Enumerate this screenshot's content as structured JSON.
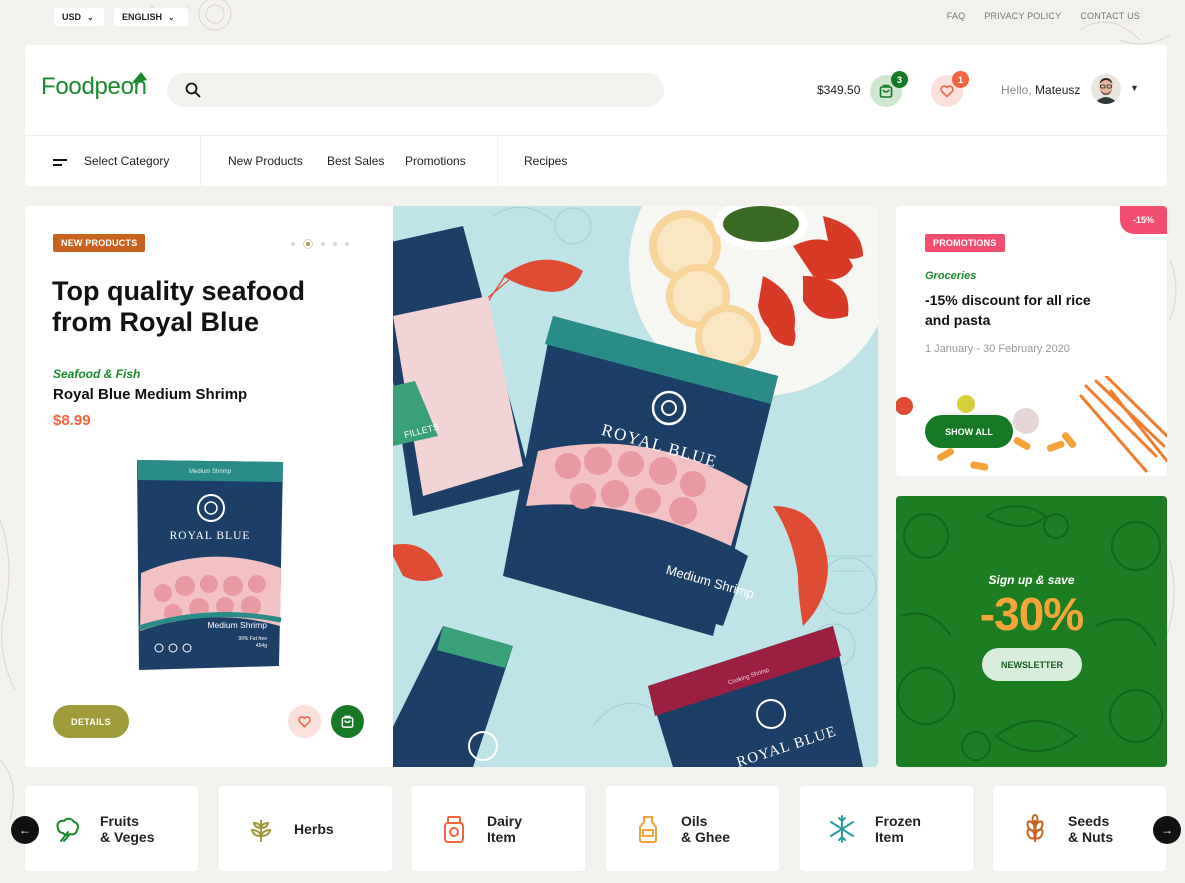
{
  "topbar": {
    "currency": "USD",
    "language": "ENGLISH",
    "links": [
      "FAQ",
      "PRIVACY POLICY",
      "CONTACT US"
    ]
  },
  "header": {
    "logo": "Foodpeon",
    "search_placeholder": "",
    "cart_total": "$349.50",
    "cart_count": "3",
    "wishlist_count": "1",
    "greeting": "Hello,",
    "user_name": "Mateusz"
  },
  "nav": {
    "category_label": "Select Category",
    "items": [
      "New Products",
      "Best Sales",
      "Promotions",
      "Recipes"
    ]
  },
  "hero": {
    "tag": "NEW PRODUCTS",
    "title": "Top quality seafood from Royal Blue",
    "category": "Seafood & Fish",
    "product_name": "Royal Blue Medium Shrimp",
    "price": "$8.99",
    "details_label": "DETAILS",
    "slide_count": 5,
    "active_slide": 2,
    "pack_brand": "ROYAL BLUE",
    "pack_type": "Medium Shrimp",
    "pack_type_2": "Cooking Shrimp",
    "pack_fat": "99% Fat free",
    "pack_weight": "454g",
    "pack_side": "FILLETS",
    "pack_top": "Medium Shrimp"
  },
  "promo": {
    "tag": "PROMOTIONS",
    "ribbon": "-15%",
    "category": "Groceries",
    "title": "-15% discount for all rice and pasta",
    "date": "1 January - 30 February 2020",
    "button": "SHOW ALL"
  },
  "newsletter": {
    "tagline": "Sign up & save",
    "discount": "-30%",
    "button": "NEWSLETTER"
  },
  "categories": [
    {
      "label": "Fruits\n& Veges",
      "icon": "broccoli-icon"
    },
    {
      "label": "Herbs",
      "icon": "herb-icon"
    },
    {
      "label": "Dairy\nItem",
      "icon": "jar-icon"
    },
    {
      "label": "Oils\n& Ghee",
      "icon": "bottle-icon"
    },
    {
      "label": "Frozen\nItem",
      "icon": "snowflake-icon"
    },
    {
      "label": "Seeds\n& Nuts",
      "icon": "wheat-icon"
    }
  ],
  "colors": {
    "brand_green": "#1a8a2e",
    "accent_orange": "#f06440",
    "tag_orange": "#c9621f",
    "tag_pink": "#f24e6f",
    "olive": "#9f9a3a",
    "newsletter_bg": "#1c7d22",
    "discount_orange": "#f6a53b"
  }
}
